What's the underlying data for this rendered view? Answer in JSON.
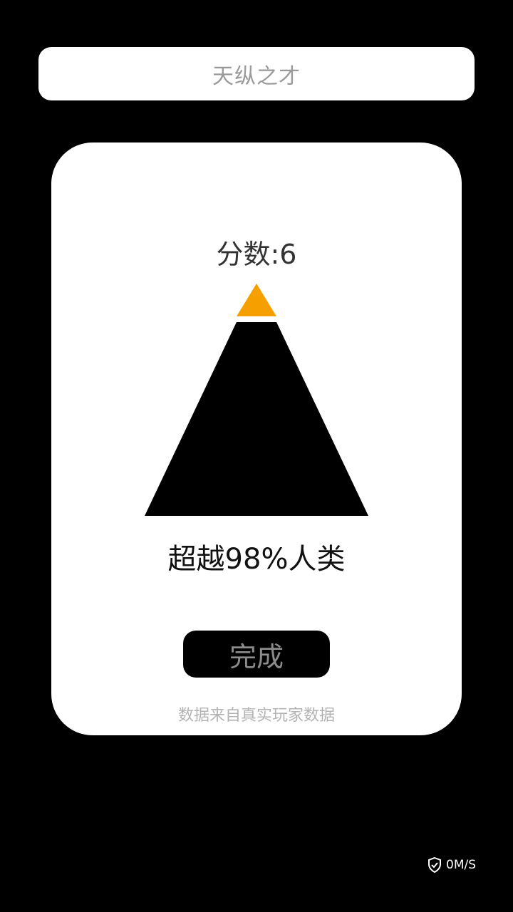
{
  "header": {
    "title": "天纵之才"
  },
  "result": {
    "score_text": "分数:6",
    "rank_text": "超越98%人类",
    "progress_fraction": 0.98
  },
  "actions": {
    "done_label": "完成"
  },
  "footer": {
    "note": "数据来自真实玩家数据"
  },
  "status_overlay": {
    "speed": "0M/S",
    "icon": "shield-check-icon"
  },
  "colors": {
    "background": "#000000",
    "card": "#ffffff",
    "pyramid_tip": "#f5a000",
    "pyramid_body": "#000000"
  }
}
